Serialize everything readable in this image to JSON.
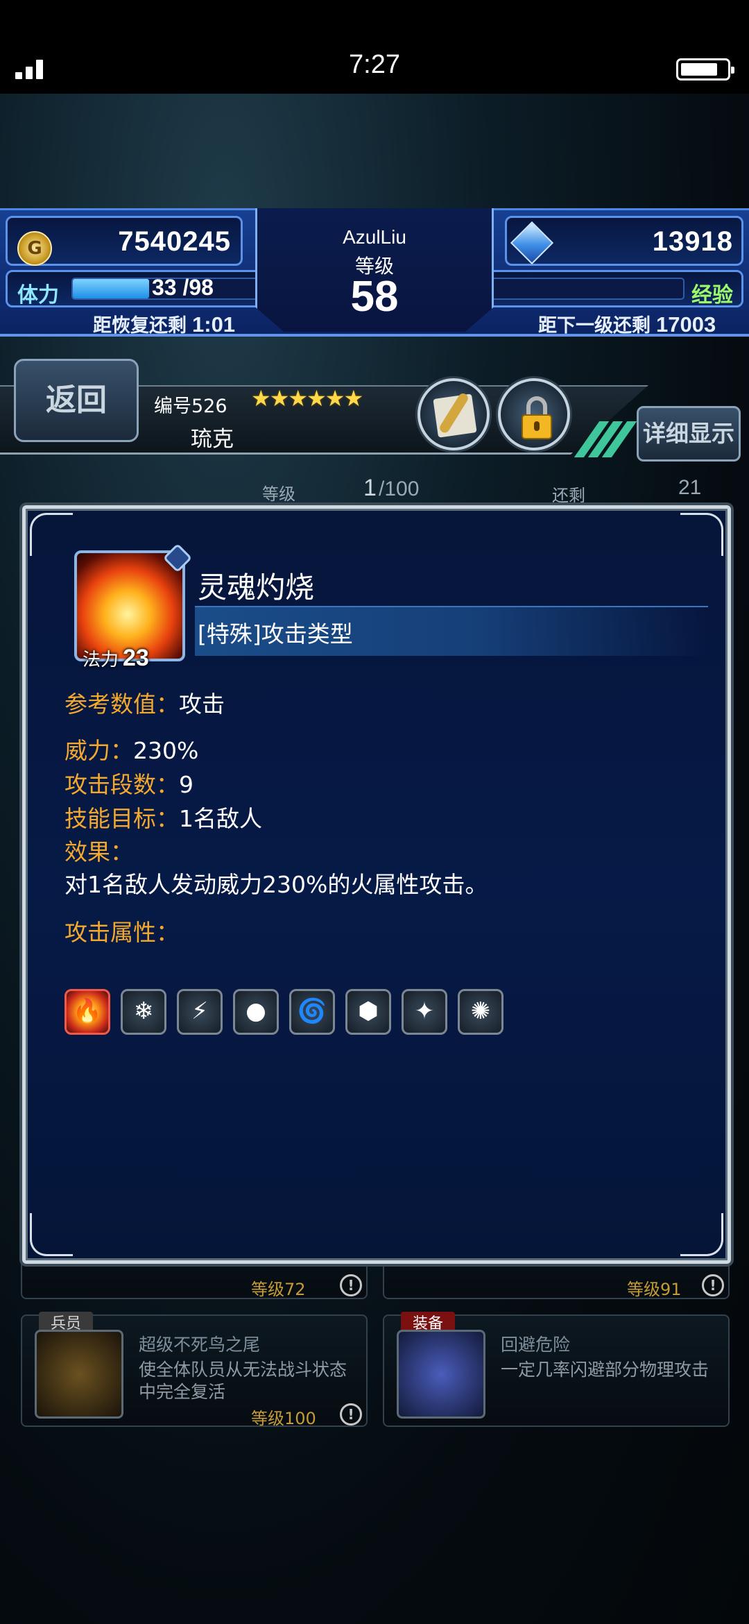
{
  "status_bar": {
    "time": "7:27"
  },
  "hud": {
    "gil": "7540245",
    "gil_icon": "coin-icon",
    "lapis": "13918",
    "lapis_icon": "crystal-icon",
    "player_name": "AzulLiu",
    "level_label": "等级",
    "level": "58",
    "stamina_label": "体力",
    "stamina_value": "33 /98",
    "stamina_fraction": 0.337,
    "recover_label": "距恢复还剩",
    "recover_time": "1:01",
    "exp_label": "经验",
    "exp_fraction": 0.02,
    "next_label": "距下一级还剩",
    "next_value": "17003"
  },
  "unit": {
    "back_label": "返回",
    "number_label": "编号526",
    "stars": "★★★★★★",
    "name": "琉克",
    "detail_label": "详细显示",
    "quill_icon": "quill-icon",
    "lock_icon": "lock-icon"
  },
  "level_row": {
    "label": "等级",
    "value": "1",
    "max": "/100",
    "remain_label": "还剩",
    "remain_value": "21"
  },
  "background_cards": [
    {
      "tag": "",
      "title": "",
      "desc": "",
      "lock": "等级72"
    },
    {
      "tag": "",
      "title": "",
      "desc": "",
      "lock": "等级91"
    },
    {
      "tag": "兵员",
      "title": "超级不死鸟之尾",
      "desc": "使全体队员从无法战斗状态中完全复活",
      "lock": "等级100"
    },
    {
      "tag": "装备",
      "title": "回避危险",
      "desc": "一定几率闪避部分物理攻击",
      "lock": ""
    }
  ],
  "skill": {
    "icon": "fire-skill-icon",
    "mp_label": "法力",
    "mp_value": "23",
    "name": "灵魂灼烧",
    "type": "[特殊]攻击类型",
    "ref_label": "参考数值",
    "ref_value": "攻击",
    "power_label": "威力",
    "power_value": "230%",
    "hits_label": "攻击段数",
    "hits_value": "9",
    "target_label": "技能目标",
    "target_value": "1名敌人",
    "effect_label": "效果",
    "effect_text": "对1名敌人发动威力230%的火属性攻击。",
    "element_label": "攻击属性",
    "elements": [
      {
        "icon": "fire-icon",
        "glyph": "🔥",
        "active": true
      },
      {
        "icon": "ice-icon",
        "glyph": "❄",
        "active": false
      },
      {
        "icon": "lightning-icon",
        "glyph": "⚡",
        "active": false
      },
      {
        "icon": "water-icon",
        "glyph": "●",
        "active": false
      },
      {
        "icon": "wind-icon",
        "glyph": "🌀",
        "active": false
      },
      {
        "icon": "earth-icon",
        "glyph": "⬢",
        "active": false
      },
      {
        "icon": "light-icon",
        "glyph": "✦",
        "active": false
      },
      {
        "icon": "dark-icon",
        "glyph": "✺",
        "active": false
      }
    ]
  }
}
